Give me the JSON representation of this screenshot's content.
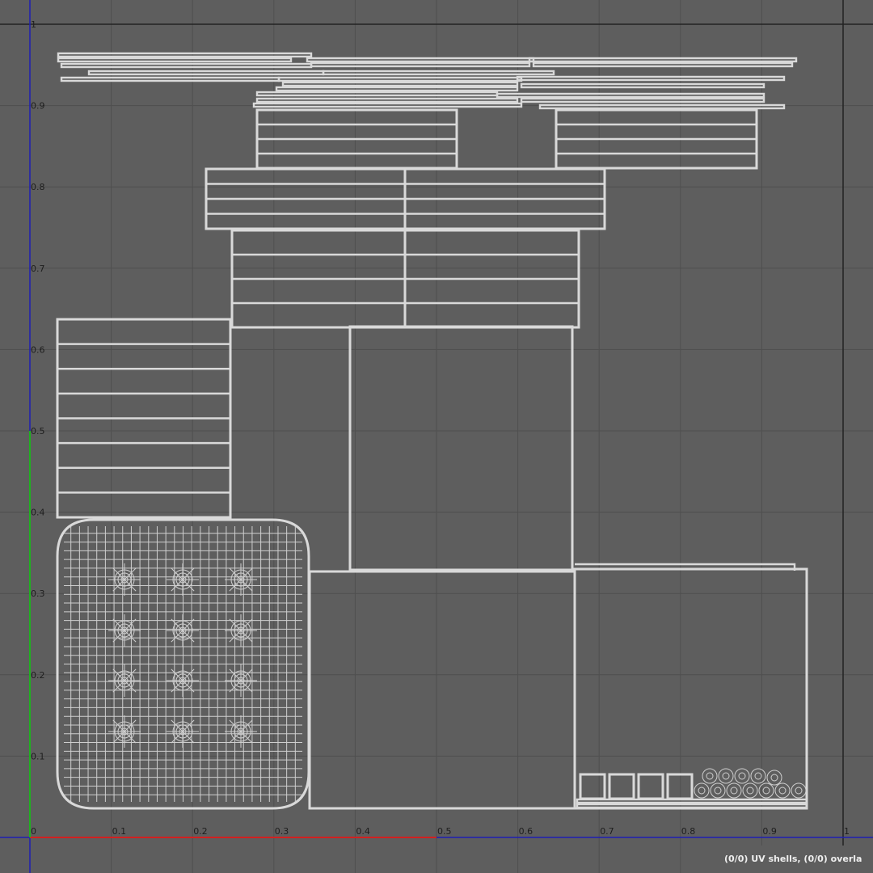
{
  "editor": {
    "view": "UV Editor",
    "u_ticks": [
      "0",
      "0.1",
      "0.2",
      "0.3",
      "0.4",
      "0.5",
      "0.6",
      "0.7",
      "0.8",
      "0.9",
      "1"
    ],
    "v_ticks": [
      "0.1",
      "0.2",
      "0.3",
      "0.4",
      "0.5",
      "0.6",
      "0.7",
      "0.8",
      "0.9",
      "1"
    ],
    "status_text": "(0/0) UV shells, (0/0) overla",
    "colors": {
      "background": "#5e5e5e",
      "grid": "#4f4f4f",
      "uv_wire": "#d9d9d9",
      "u_axis": "#d22020",
      "v_axis": "#20b020",
      "frame_blue": "#1e1eb4",
      "frame_dark": "#222222"
    }
  }
}
